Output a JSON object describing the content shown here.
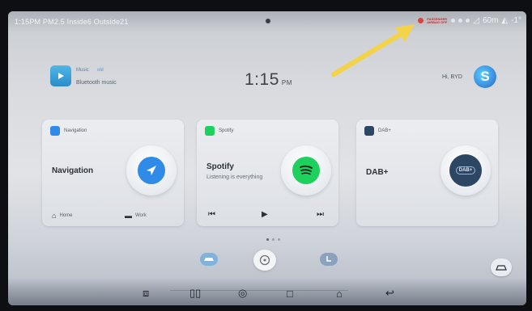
{
  "status": {
    "left_text": "1:15PM PM2.5 Inside6 Outside21",
    "airbag_text": "PASSENGER AIRBAG OFF",
    "right_text": "60m",
    "temperature": "-1°"
  },
  "header": {
    "music_label": "Music",
    "music_eq": "ıılıl",
    "music_source": "Bluetooth music",
    "time": "1:15",
    "time_suffix": "PM",
    "greeting": "Hi, BYD",
    "brand_letter": "S"
  },
  "cards": {
    "navigation": {
      "header": "Navigation",
      "title": "Navigation",
      "home_label": "Home",
      "work_label": "Work"
    },
    "spotify": {
      "header": "Spotify",
      "title": "Spotify",
      "subtitle": "Listening is everything"
    },
    "dab": {
      "header": "DAB+",
      "title": "DAB+",
      "badge": "DAB+"
    }
  },
  "colors": {
    "annotation_arrow": "#f3d34a",
    "navigation_accent": "#2f8be7",
    "spotify_accent": "#1ed05e",
    "dab_accent": "#2d4663"
  },
  "icons": {
    "music": "music-app-icon",
    "navigation": "navigation-arrow-icon",
    "spotify": "spotify-icon",
    "dab": "dab-radio-icon",
    "home": "home-icon",
    "work": "briefcase-icon"
  }
}
